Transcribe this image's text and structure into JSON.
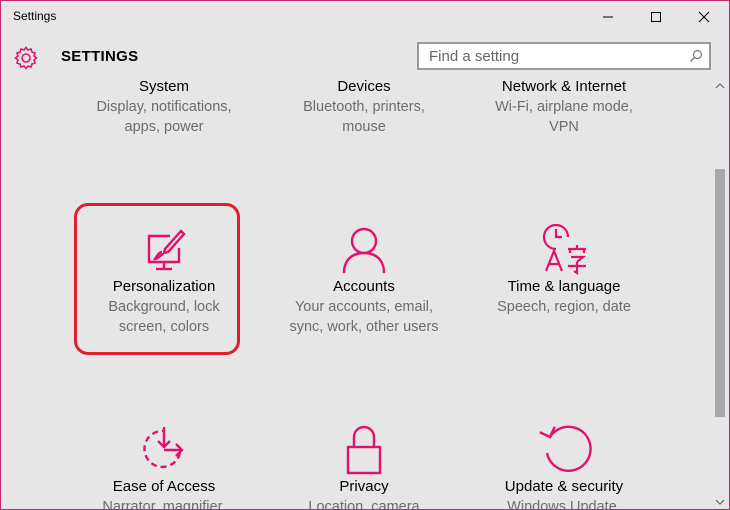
{
  "window": {
    "title": "Settings"
  },
  "header": {
    "title": "SETTINGS"
  },
  "search": {
    "placeholder": "Find a setting"
  },
  "tiles": [
    {
      "name": "System",
      "desc1": "Display, notifications,",
      "desc2": "apps, power"
    },
    {
      "name": "Devices",
      "desc1": "Bluetooth, printers,",
      "desc2": "mouse"
    },
    {
      "name": "Network & Internet",
      "desc1": "Wi-Fi, airplane mode,",
      "desc2": "VPN"
    },
    {
      "name": "Personalization",
      "desc1": "Background, lock",
      "desc2": "screen, colors",
      "icon": "personalization-icon"
    },
    {
      "name": "Accounts",
      "desc1": "Your accounts, email,",
      "desc2": "sync, work, other users",
      "icon": "accounts-icon"
    },
    {
      "name": "Time & language",
      "desc1": "Speech, region, date",
      "desc2": "",
      "icon": "time-language-icon"
    },
    {
      "name": "Ease of Access",
      "desc1": "Narrator, magnifier,",
      "desc2": "",
      "icon": "ease-of-access-icon"
    },
    {
      "name": "Privacy",
      "desc1": "Location, camera",
      "desc2": "",
      "icon": "privacy-icon"
    },
    {
      "name": "Update & security",
      "desc1": "Windows Update,",
      "desc2": "",
      "icon": "update-security-icon"
    }
  ],
  "colors": {
    "accent": "#e3106e",
    "highlight": "#e0202a",
    "background": "#e6e6e6"
  }
}
